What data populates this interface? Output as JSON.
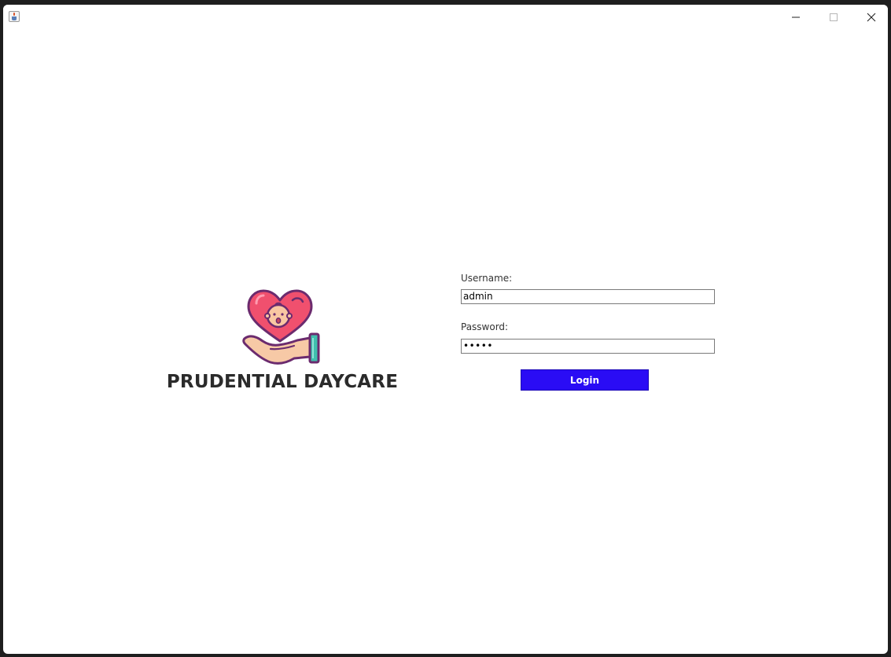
{
  "window": {
    "title": "",
    "controls": {
      "minimize_icon": "minimize-icon",
      "maximize_icon": "maximize-icon",
      "close_icon": "close-icon"
    }
  },
  "brand": {
    "title": "PRUDENTIAL DAYCARE",
    "logo_icon": "heart-baby-hand-icon",
    "colors": {
      "heart": "#f0506e",
      "outline": "#6b2b6e",
      "hand": "#f7c9a6",
      "cuff": "#3fbfae"
    }
  },
  "login": {
    "username_label": "Username:",
    "username_value": "admin",
    "password_label": "Password:",
    "password_value": "•••••",
    "login_label": "Login",
    "button_color": "#2a0cf5"
  }
}
